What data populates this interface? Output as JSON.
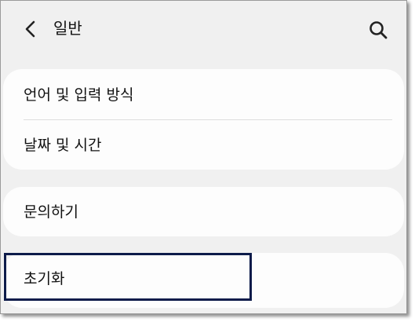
{
  "header": {
    "title": "일반",
    "back_icon": "chevron-left-icon",
    "search_icon": "search-icon"
  },
  "groups": [
    {
      "items": [
        {
          "label": "언어 및 입력 방식"
        },
        {
          "label": "날짜 및 시간"
        }
      ]
    },
    {
      "items": [
        {
          "label": "문의하기"
        }
      ]
    },
    {
      "items": [
        {
          "label": "초기화"
        }
      ]
    }
  ],
  "highlight": {
    "target": "초기화",
    "color": "#0d1b4a"
  }
}
